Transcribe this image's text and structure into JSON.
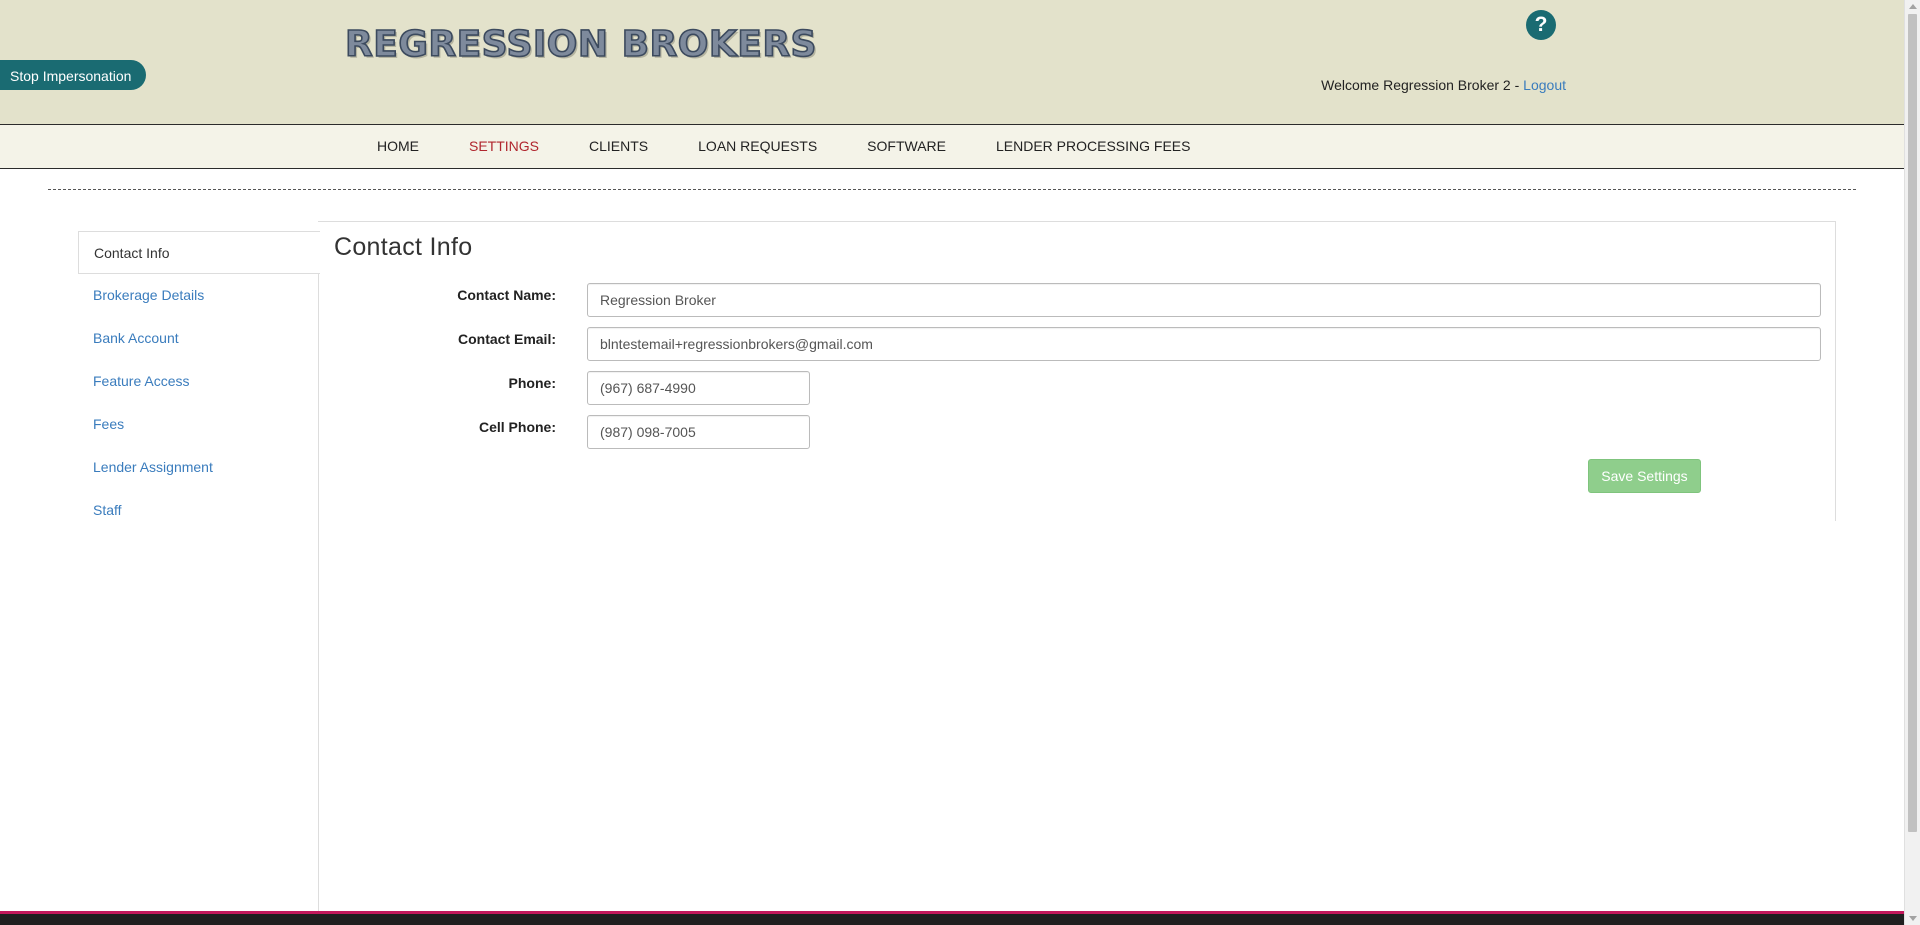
{
  "header": {
    "stop_impersonation": "Stop Impersonation",
    "logo_text": "REGRESSION BROKERS",
    "help_symbol": "?",
    "welcome_text": "Welcome Regression Broker 2 - ",
    "logout_label": "Logout"
  },
  "nav": {
    "items": [
      "HOME",
      "SETTINGS",
      "CLIENTS",
      "LOAN REQUESTS",
      "SOFTWARE",
      "LENDER PROCESSING FEES"
    ],
    "active": "SETTINGS"
  },
  "sidebar": {
    "items": [
      "Contact Info",
      "Brokerage Details",
      "Bank Account",
      "Feature Access",
      "Fees",
      "Lender Assignment",
      "Staff"
    ],
    "active": "Contact Info"
  },
  "form": {
    "title": "Contact Info",
    "contact_name_label": "Contact Name:",
    "contact_name_value": "Regression Broker",
    "contact_email_label": "Contact Email:",
    "contact_email_value": "blntestemail+regressionbrokers@gmail.com",
    "phone_label": "Phone:",
    "phone_value": "(967) 687-4990",
    "cell_phone_label": "Cell Phone:",
    "cell_phone_value": "(987) 098-7005",
    "save_label": "Save Settings"
  },
  "colors": {
    "header_bg": "#e3e2cb",
    "accent_teal": "#1a6b72",
    "active_nav": "#b0262e",
    "link_blue": "#3a7cbd",
    "save_green": "#8fce8c"
  }
}
